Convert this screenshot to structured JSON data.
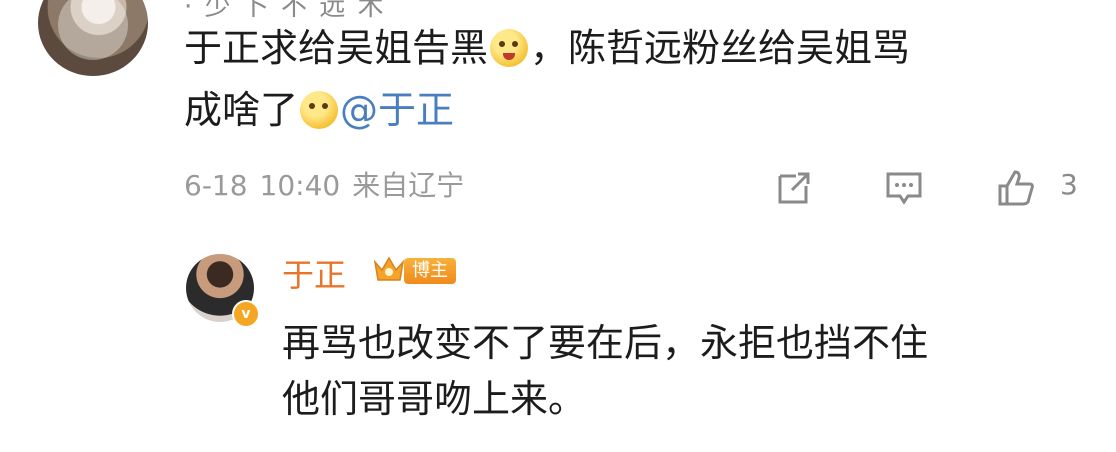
{
  "comment": {
    "line1_a": "于正求给吴姐告黑",
    "line1_b": "，陈哲远粉丝给吴姐骂",
    "line2_a": "成啥了",
    "mention": "@于正",
    "emoji1": "scared-face-emoji",
    "emoji2": "thinking-face-emoji"
  },
  "meta": {
    "date": "6-18",
    "time": "10:40",
    "location": "来自辽宁"
  },
  "actions": {
    "share_icon": "share-icon",
    "comment_icon": "comment-icon",
    "like_icon": "thumbs-up-icon",
    "like_count": "3"
  },
  "reply": {
    "name": "于正",
    "badge": "博主",
    "line1": "再骂也改变不了要在后，永拒也挡不住",
    "line2": "他们哥哥吻上来。"
  },
  "colors": {
    "name_color": "#e8742a",
    "mention_color": "#4a7fbf",
    "meta_color": "#9a9a9a",
    "badge_color": "#f5a623"
  }
}
